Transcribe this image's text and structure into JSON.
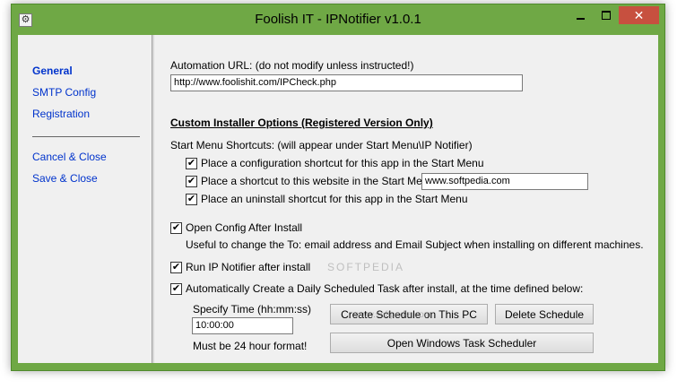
{
  "window": {
    "title": "Foolish IT - IPNotifier   v1.0.1",
    "close_glyph": "✕",
    "icon_glyph": "⚙"
  },
  "nav": {
    "items": [
      "General",
      "SMTP Config",
      "Registration"
    ],
    "actions": [
      "Cancel & Close",
      "Save & Close"
    ]
  },
  "main": {
    "automation_url_label": "Automation URL:  (do not modify unless instructed!)",
    "automation_url_value": "http://www.foolishit.com/IPCheck.php",
    "custom_heading": "Custom Installer Options  (Registered Version Only)",
    "start_menu_label": "Start Menu Shortcuts:  (will appear under Start Menu\\IP Notifier)",
    "shortcut_config": {
      "label": "Place a configuration shortcut for this app in the Start Menu",
      "checked": true
    },
    "shortcut_website": {
      "label": "Place a shortcut to this website in the Start Menu:",
      "checked": true,
      "value": "www.softpedia.com"
    },
    "shortcut_uninstall": {
      "label": "Place an uninstall shortcut for this app in the Start Menu",
      "checked": true
    },
    "open_config": {
      "label": "Open Config After Install",
      "checked": true
    },
    "open_config_hint": "Useful to change the To: email address and Email Subject when installing on different machines.",
    "run_after": {
      "label": "Run IP Notifier after install",
      "checked": true
    },
    "auto_task": {
      "label": "Automatically Create a Daily Scheduled Task after install, at the time defined below:",
      "checked": true
    },
    "specify_time_label": "Specify Time (hh:mm:ss)",
    "time_value": "10:00:00",
    "time_hint": "Must be 24 hour format!",
    "create_schedule_button": "Create Schedule on This PC",
    "delete_schedule_button": "Delete Schedule",
    "open_scheduler_button": "Open Windows Task Scheduler"
  },
  "watermark": {
    "main": "SOFTPEDIA",
    "url": "www.softpedia.com"
  },
  "check_glyph": "✔"
}
